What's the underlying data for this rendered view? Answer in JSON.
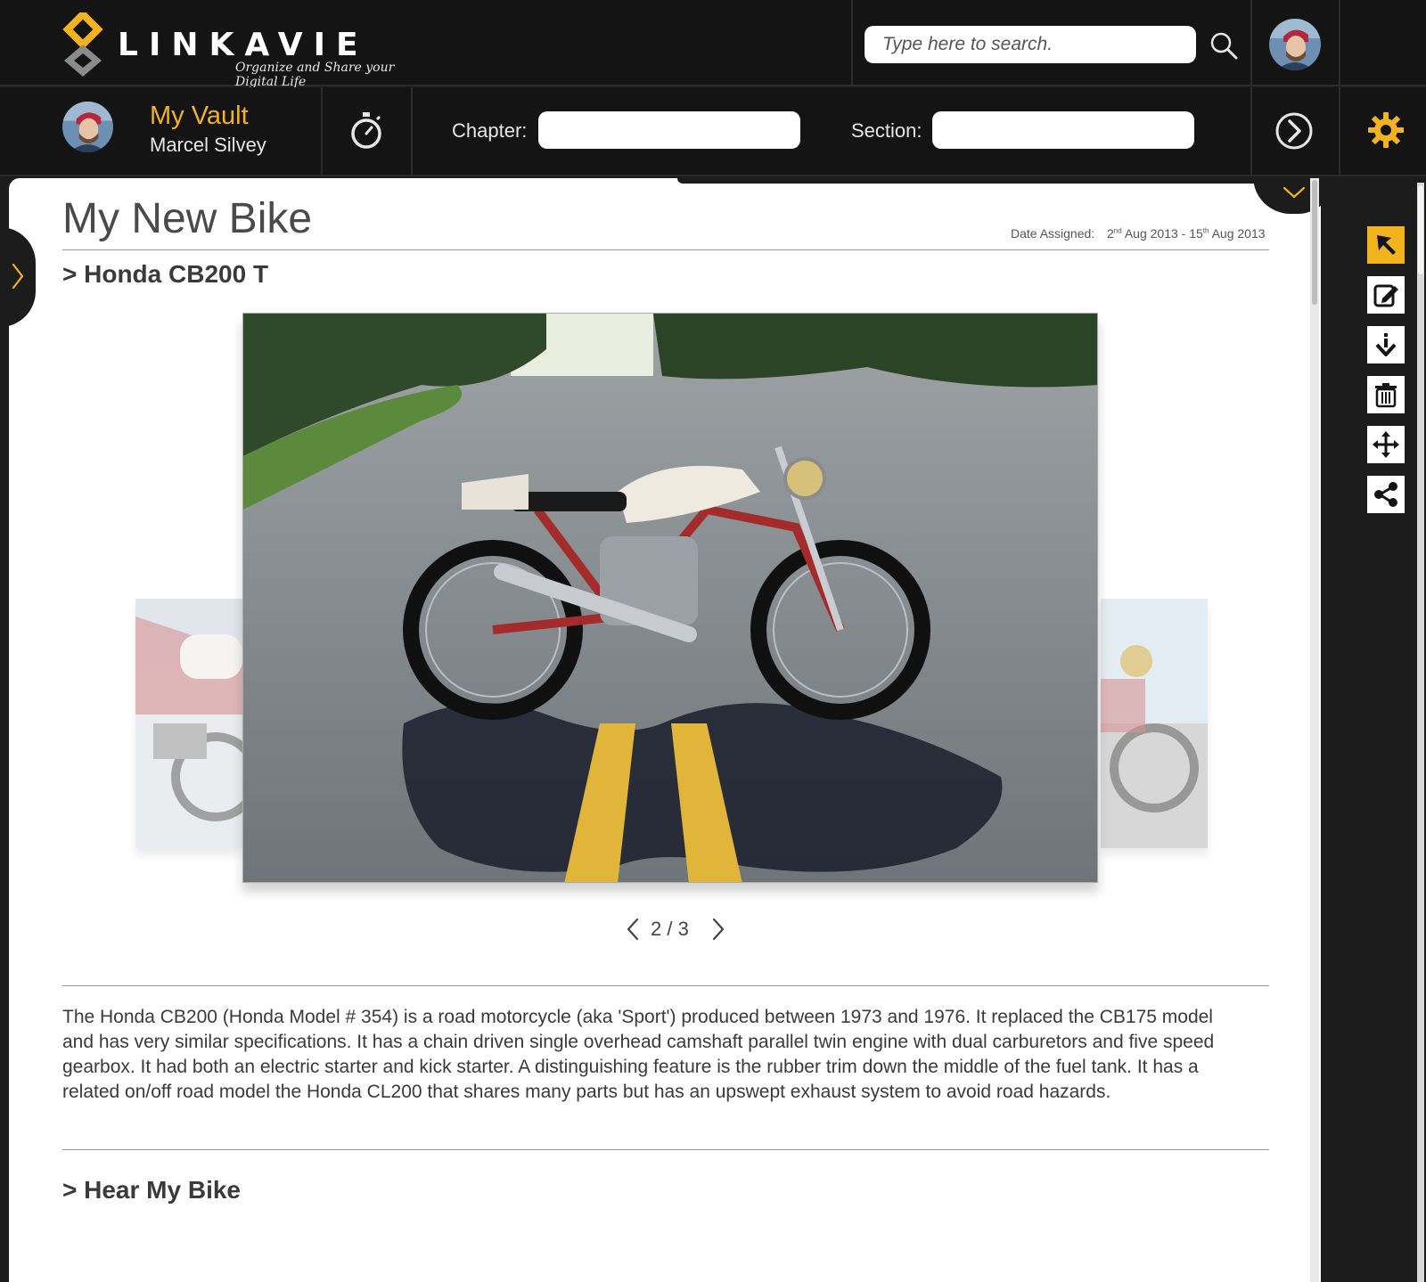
{
  "brand": {
    "name": "LINKAVIE",
    "tagline": "Organize and Share your Digital Life"
  },
  "header": {
    "search": {
      "placeholder": "Type here to search."
    },
    "icons": {
      "search": "search-icon",
      "avatar": "user-avatar"
    }
  },
  "subheader": {
    "vault_title": "My Vault",
    "user_name": "Marcel Silvey",
    "chapter": {
      "label": "Chapter:",
      "value": ""
    },
    "section": {
      "label": "Section:",
      "value": ""
    },
    "icons": {
      "timer": "stopwatch-icon",
      "next": "arrow-right-circle-icon",
      "settings": "gear-icon"
    }
  },
  "entry": {
    "title": "My New Bike",
    "date_label": "Date Assigned:",
    "date_start": {
      "day": "2",
      "suffix": "nd",
      "rest": "Aug 2013 -"
    },
    "date_end": {
      "day": "15",
      "suffix": "th",
      "rest": "Aug 2013"
    },
    "section_title": "> Honda CB200 T",
    "gallery": {
      "current": 2,
      "total": 3,
      "counter": "2 / 3"
    },
    "description": "The Honda CB200 (Honda Model # 354) is a road motorcycle (aka 'Sport') produced between 1973 and 1976. It replaced the CB175 model and has very similar specifications. It has a chain driven single overhead camshaft parallel twin engine with dual carburetors and five speed gearbox. It had both an electric starter and kick starter. A distinguishing feature is the rubber trim down the middle of the fuel tank. It has a related on/off road model the Honda CL200 that shares many parts but has an upswept exhaust system to avoid road hazards.",
    "next_section_title": "> Hear My Bike"
  },
  "toolbar": {
    "tools": [
      "select-pointer-icon",
      "edit-icon",
      "download-icon",
      "trash-icon",
      "move-icon",
      "share-icon"
    ],
    "active": "select-pointer-icon"
  },
  "colors": {
    "accent": "#f2b31f",
    "bar_bg": "#141414",
    "panel_bg": "#1c1c1c",
    "content_bg": "#ffffff",
    "text": "#3a3a3a"
  }
}
